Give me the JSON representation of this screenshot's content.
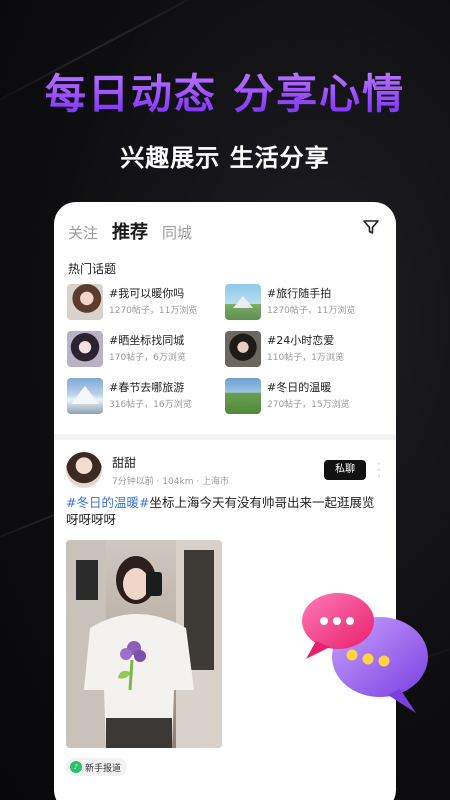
{
  "promo": {
    "headline": "每日动态 分享心情",
    "subheadline": "兴趣展示 生活分享"
  },
  "tabs": [
    {
      "label": "关注",
      "active": false
    },
    {
      "label": "推荐",
      "active": true
    },
    {
      "label": "同城",
      "active": false
    }
  ],
  "filter_icon": "filter-icon",
  "hot_topics": {
    "title": "热门话题",
    "items": [
      {
        "name": "#我可以暖你吗",
        "meta": "1270帖子，11万浏览"
      },
      {
        "name": "#旅行随手拍",
        "meta": "1270帖子，11万浏览"
      },
      {
        "name": "#晒坐标找同城",
        "meta": "170帖子，6万浏览"
      },
      {
        "name": "#24小时恋爱",
        "meta": "110帖子，1万浏览"
      },
      {
        "name": "#春节去哪旅游",
        "meta": "316帖子，16万浏览"
      },
      {
        "name": "#冬日的温暖",
        "meta": "270帖子，15万浏览"
      }
    ]
  },
  "post": {
    "user_name": "甜甜",
    "meta": "7分钟以前 · 104km · 上海市",
    "dm_label": "私聊",
    "hashtag": "#冬日的温暖#",
    "text": "坐标上海今天有没有帅哥出来一起逛展览呀呀呀呀",
    "badge": "新手报道"
  },
  "colors": {
    "accent_purple": "#9b4dff",
    "hashtag_blue": "#3a72d8",
    "bubble_pink": "#ff3d8a",
    "bubble_purple": "#a06bff"
  }
}
